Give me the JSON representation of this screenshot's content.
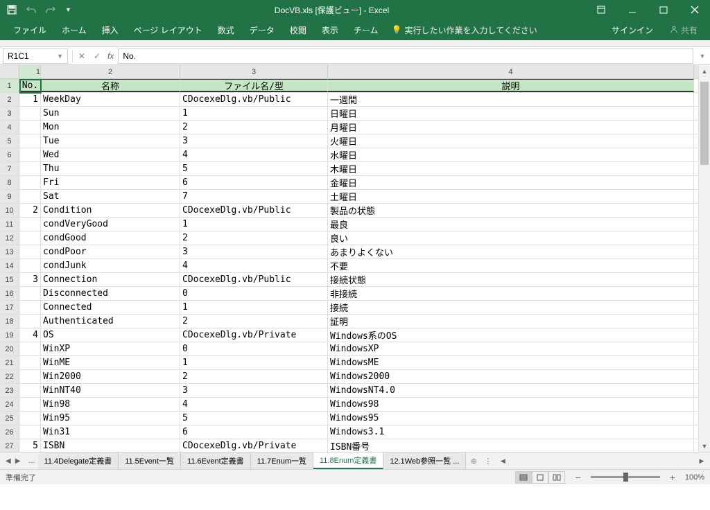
{
  "titlebar": {
    "title": "DocVB.xls  [保護ビュー] - Excel"
  },
  "ribbon": {
    "tabs": [
      "ファイル",
      "ホーム",
      "挿入",
      "ページ レイアウト",
      "数式",
      "データ",
      "校閲",
      "表示",
      "チーム"
    ],
    "tell_me": "実行したい作業を入力してください",
    "signin": "サインイン",
    "share": "共有"
  },
  "formula_bar": {
    "name_box": "R1C1",
    "content": "No."
  },
  "grid": {
    "col_numbers": [
      "1",
      "2",
      "3",
      "4"
    ],
    "headers": [
      "No.",
      "名称",
      "ファイル名/型",
      "説明"
    ],
    "rows": [
      [
        "1",
        "WeekDay",
        "CDocexeDlg.vb/Public",
        "一週間"
      ],
      [
        "",
        "Sun",
        "1",
        "日曜日"
      ],
      [
        "",
        "Mon",
        "2",
        "月曜日"
      ],
      [
        "",
        "Tue",
        "3",
        "火曜日"
      ],
      [
        "",
        "Wed",
        "4",
        "水曜日"
      ],
      [
        "",
        "Thu",
        "5",
        "木曜日"
      ],
      [
        "",
        "Fri",
        "6",
        "金曜日"
      ],
      [
        "",
        "Sat",
        "7",
        "土曜日"
      ],
      [
        "2",
        "Condition",
        "CDocexeDlg.vb/Public",
        "製品の状態"
      ],
      [
        "",
        "condVeryGood",
        "1",
        "最良"
      ],
      [
        "",
        "condGood",
        "2",
        "良い"
      ],
      [
        "",
        "condPoor",
        "3",
        "あまりよくない"
      ],
      [
        "",
        "condJunk",
        "4",
        "不要"
      ],
      [
        "3",
        "Connection",
        "CDocexeDlg.vb/Public",
        "接続状態"
      ],
      [
        "",
        "Disconnected",
        "0",
        "非接続"
      ],
      [
        "",
        "Connected",
        "1",
        "接続"
      ],
      [
        "",
        "Authenticated",
        "2",
        "証明"
      ],
      [
        "4",
        "OS",
        "CDocexeDlg.vb/Private",
        "Windows系のOS"
      ],
      [
        "",
        "WinXP",
        "0",
        "WindowsXP"
      ],
      [
        "",
        "WinME",
        "1",
        "WindowsME"
      ],
      [
        "",
        "Win2000",
        "2",
        "Windows2000"
      ],
      [
        "",
        "WinNT40",
        "3",
        "WindowsNT4.0"
      ],
      [
        "",
        "Win98",
        "4",
        "Windows98"
      ],
      [
        "",
        "Win95",
        "5",
        "Windows95"
      ],
      [
        "",
        "Win31",
        "6",
        "Windows3.1"
      ],
      [
        "5",
        "ISBN",
        "CDocexeDlg.vb/Private",
        "ISBN番号"
      ]
    ]
  },
  "sheet_tabs": {
    "tabs": [
      "11.4Delegate定義書",
      "11.5Event一覧",
      "11.6Event定義書",
      "11.7Enum一覧",
      "11.8Enum定義書",
      "12.1Web参照一覧 ..."
    ],
    "active": 4,
    "ellipsis": "..."
  },
  "statusbar": {
    "ready": "準備完了",
    "zoom": "100%"
  }
}
